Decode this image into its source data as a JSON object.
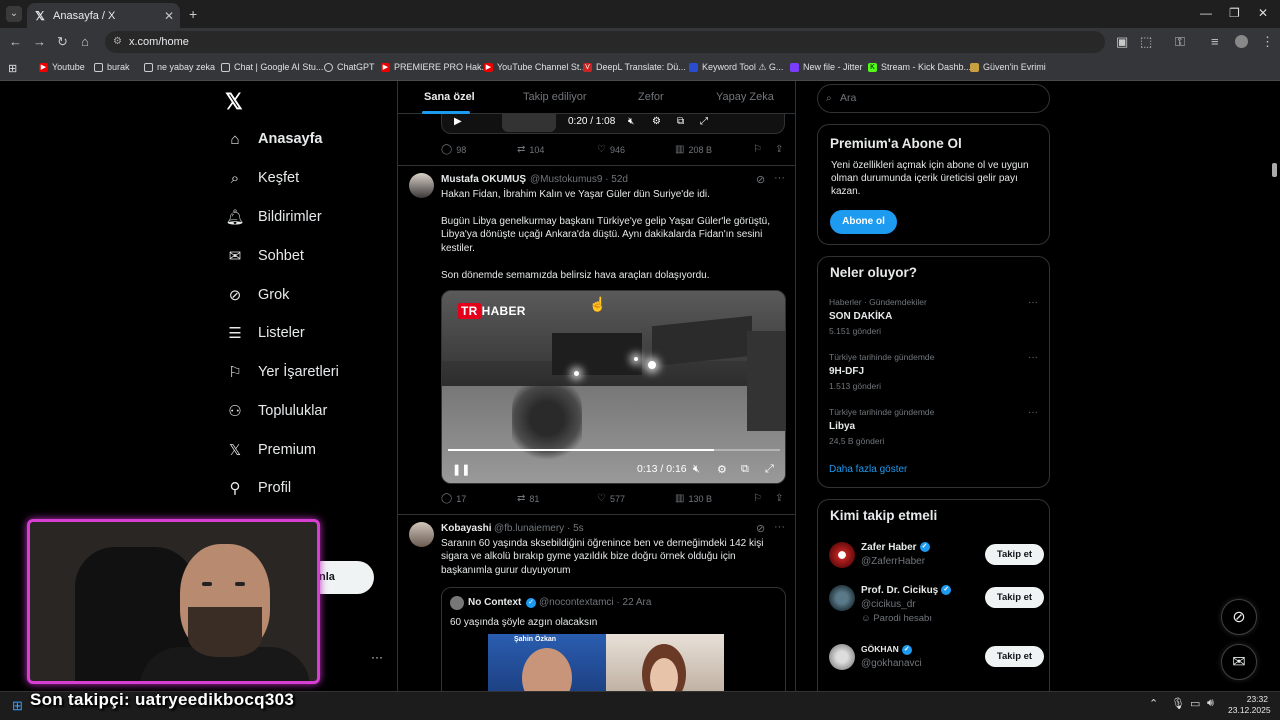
{
  "browser": {
    "tab_title": "Anasayfa / X",
    "url": "x.com/home",
    "bookmarks": [
      "Youtube",
      "burak",
      "ne yabay zeka",
      "Chat | Google AI Stu...",
      "ChatGPT",
      "PREMIERE PRO Hak...",
      "YouTube Channel St...",
      "DeepL Translate: Dü...",
      "Keyword Tool ⚠ G...",
      "New file - Jitter",
      "Stream - Kick Dashb...",
      "Güven'in Evrimi"
    ]
  },
  "nav": {
    "items": [
      "Anasayfa",
      "Keşfet",
      "Bildirimler",
      "Sohbet",
      "Grok",
      "Listeler",
      "Yer İşaretleri",
      "Topluluklar",
      "Premium",
      "Profil"
    ],
    "post_button_partial": "nla"
  },
  "feed_tabs": [
    "Sana özel",
    "Takip ediliyor",
    "Zefor",
    "Yapay Zeka"
  ],
  "post0": {
    "video_time": "0:20 / 1:08",
    "replies": "98",
    "reposts": "104",
    "likes": "946",
    "views": "208 B"
  },
  "post1": {
    "name": "Mustafa OKUMUŞ",
    "handle": "@Mustokumus9 · 52d",
    "line1": "Hakan Fidan, İbrahim Kalın ve Yaşar Güler dün Suriye'de idi.",
    "para2": "Bugün Libya genelkurmay başkanı Türkiye'ye gelip Yaşar Güler'le görüştü, Libya'ya dönüşte uçağı Ankara'da düştü. Aynı dakikalarda Fidan'ın sesini kestiler.",
    "line3": "Son dönemde semamızda belirsiz hava araçları dolaşıyordu.",
    "video_logo": "HABER",
    "video_logo_tr": "TR",
    "video_time": "0:13 / 0:16",
    "video_progress": 0.8,
    "replies": "17",
    "reposts": "81",
    "likes": "577",
    "views": "130 B"
  },
  "post2": {
    "name": "Kobayashi",
    "handle": "@fb.lunaiemery · 5s",
    "text": "Saranın 60 yaşında sksebildiğini öğrenince ben ve derneğimdeki 142 kişi sigara ve alkolü bırakıp gyme yazıldık bize doğru örnek olduğu için başkanımla gurur duyuyorum",
    "quote_name": "No Context",
    "quote_handle": "@nocontextamci · 22 Ara",
    "quote_text": "60 yaşında şöyle azgın olacaksın",
    "quote_caption": "Şahin Özkan"
  },
  "right": {
    "search_placeholder": "Ara",
    "premium_title": "Premium'a Abone Ol",
    "premium_text": "Yeni özellikleri açmak için abone ol ve uygun olman durumunda içerik üreticisi gelir payı kazan.",
    "premium_button": "Abone ol",
    "trends_title": "Neler oluyor?",
    "trends": [
      {
        "category": "Haberler · Gündemdekiler",
        "title": "SON DAKİKA",
        "count": "5.151 gönderi"
      },
      {
        "category": "Türkiye tarihinde gündemde",
        "title": "9H-DFJ",
        "count": "1.513 gönderi"
      },
      {
        "category": "Türkiye tarihinde gündemde",
        "title": "Libya",
        "count": "24,5 B gönderi"
      }
    ],
    "show_more": "Daha fazla göster",
    "who_title": "Kimi takip etmeli",
    "who": [
      {
        "name": "Zafer Haber",
        "handle": "@ZaferrHaber",
        "extra": ""
      },
      {
        "name": "Prof. Dr. Cicikuş",
        "handle": "@cicikus_dr",
        "extra": "Parodi hesabı"
      },
      {
        "name": "GÖKHAN",
        "handle": "@gokhanavci",
        "extra": ""
      }
    ],
    "follow_label": "Takip et"
  },
  "overlay": {
    "text": "Son takipçi: uatryeedikbocq303"
  },
  "taskbar": {
    "time": "23:32",
    "date": "23.12.2025"
  }
}
